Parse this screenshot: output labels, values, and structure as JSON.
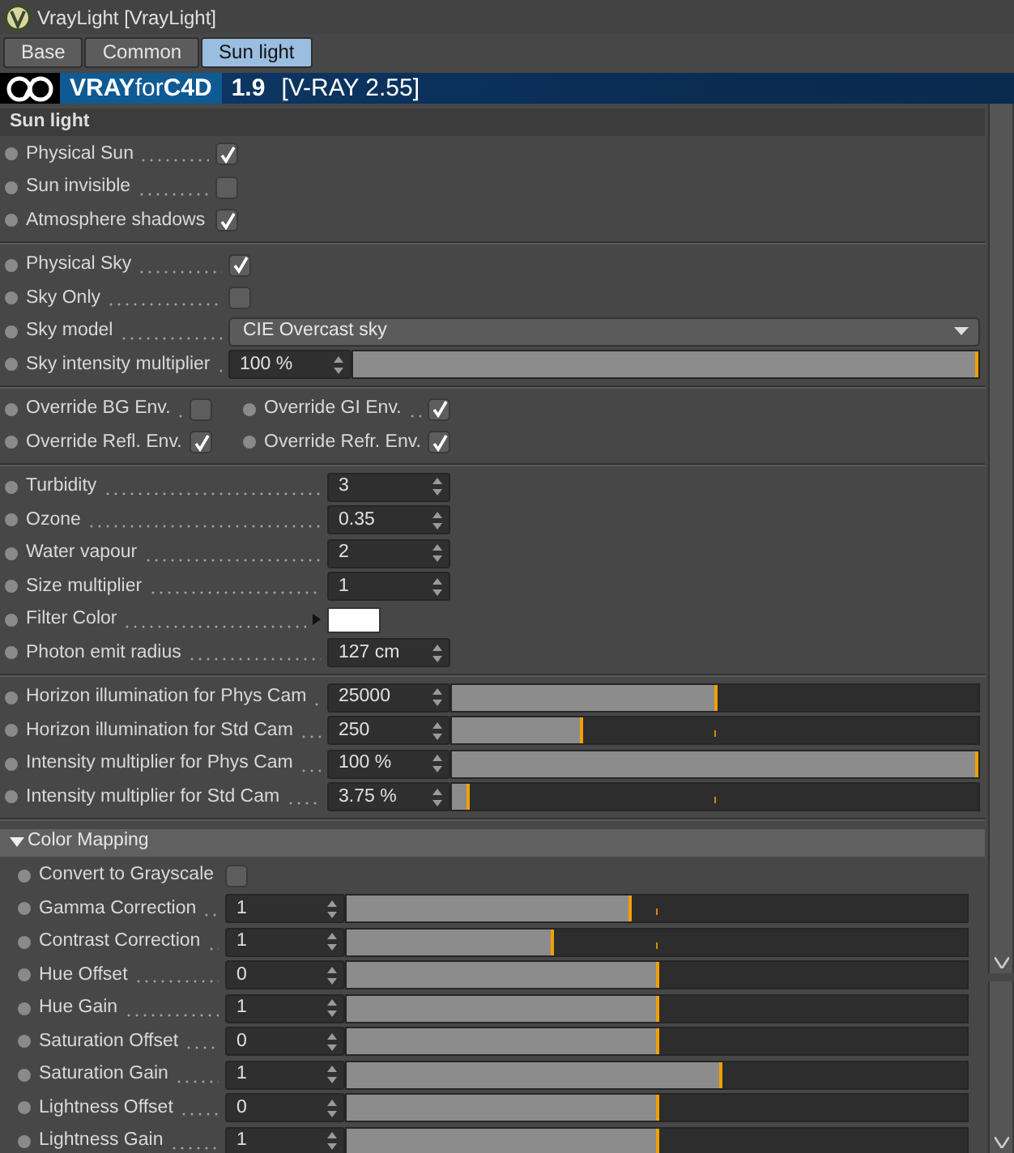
{
  "window": {
    "title": "VrayLight [VrayLight]"
  },
  "tabs": [
    {
      "label": "Base",
      "selected": false
    },
    {
      "label": "Common",
      "selected": false
    },
    {
      "label": "Sun light",
      "selected": true
    }
  ],
  "banner": {
    "product": "**VRAY**for**C4D**",
    "version": "1.9",
    "engine": "[V-RAY 2.55]"
  },
  "section_title": "Sun light",
  "groups": [
    {
      "kind": "list",
      "rows": [
        {
          "kind": "checkbox",
          "label": "Physical Sun",
          "checked": true
        },
        {
          "kind": "checkbox",
          "label": "Sun invisible",
          "checked": false
        },
        {
          "kind": "checkbox",
          "label": "Atmosphere shadows",
          "checked": true
        }
      ]
    },
    {
      "kind": "list",
      "rows": [
        {
          "kind": "checkbox",
          "label": "Physical Sky",
          "checked": true
        },
        {
          "kind": "checkbox",
          "label": "Sky Only",
          "checked": false
        },
        {
          "kind": "dropdown",
          "label": "Sky model",
          "value": "CIE Overcast sky"
        },
        {
          "kind": "slider",
          "label": "Sky intensity multiplier",
          "value": "100 %",
          "level": 1
        }
      ]
    },
    {
      "kind": "grid",
      "rows": [
        {
          "kind": "checkbox",
          "label": "Override BG Env.",
          "checked": false
        },
        {
          "kind": "checkbox",
          "label": "Override GI Env.",
          "checked": true
        },
        {
          "kind": "checkbox",
          "label": "Override Refl. Env.",
          "checked": true
        },
        {
          "kind": "checkbox",
          "label": "Override Refr. Env.",
          "checked": true
        }
      ]
    },
    {
      "kind": "list",
      "rows": [
        {
          "kind": "number",
          "label": "Turbidity",
          "value": "3"
        },
        {
          "kind": "number",
          "label": "Ozone",
          "value": "0.35"
        },
        {
          "kind": "number",
          "label": "Water vapour",
          "value": "2"
        },
        {
          "kind": "number",
          "label": "Size multiplier",
          "value": "1"
        },
        {
          "kind": "color",
          "label": "Filter Color",
          "color": "#ffffff"
        },
        {
          "kind": "number",
          "label": "Photon emit radius",
          "value": "127 cm"
        }
      ]
    },
    {
      "kind": "list",
      "rows": [
        {
          "kind": "slider",
          "label": "Horizon illumination for Phys Cam",
          "value": "25000",
          "level": 0.505
        },
        {
          "kind": "slider",
          "label": "Horizon illumination for Std Cam",
          "value": "250",
          "level": 0.25
        },
        {
          "kind": "slider",
          "label": "Intensity multiplier for Phys Cam",
          "value": "100 %",
          "level": 1
        },
        {
          "kind": "slider",
          "label": "Intensity multiplier for Std Cam",
          "value": "3.75 %",
          "level": 0.035
        }
      ]
    }
  ],
  "color_mapping": {
    "title": "Color Mapping",
    "expanded": true,
    "rows": [
      {
        "kind": "checkbox",
        "label": "Convert to Grayscale",
        "checked": false
      },
      {
        "kind": "slider",
        "label": "Gamma Correction",
        "value": "1",
        "level": 0.46
      },
      {
        "kind": "slider",
        "label": "Contrast Correction",
        "value": "1",
        "level": 0.335
      },
      {
        "kind": "slider",
        "label": "Hue Offset",
        "value": "0",
        "level": 0.505
      },
      {
        "kind": "slider",
        "label": "Hue Gain",
        "value": "1",
        "level": 0.505
      },
      {
        "kind": "slider",
        "label": "Saturation Offset",
        "value": "0",
        "level": 0.505
      },
      {
        "kind": "slider",
        "label": "Saturation Gain",
        "value": "1",
        "level": 0.605
      },
      {
        "kind": "slider",
        "label": "Lightness Offset",
        "value": "0",
        "level": 0.505
      },
      {
        "kind": "slider",
        "label": "Lightness Gain",
        "value": "1",
        "level": 0.505
      }
    ]
  }
}
